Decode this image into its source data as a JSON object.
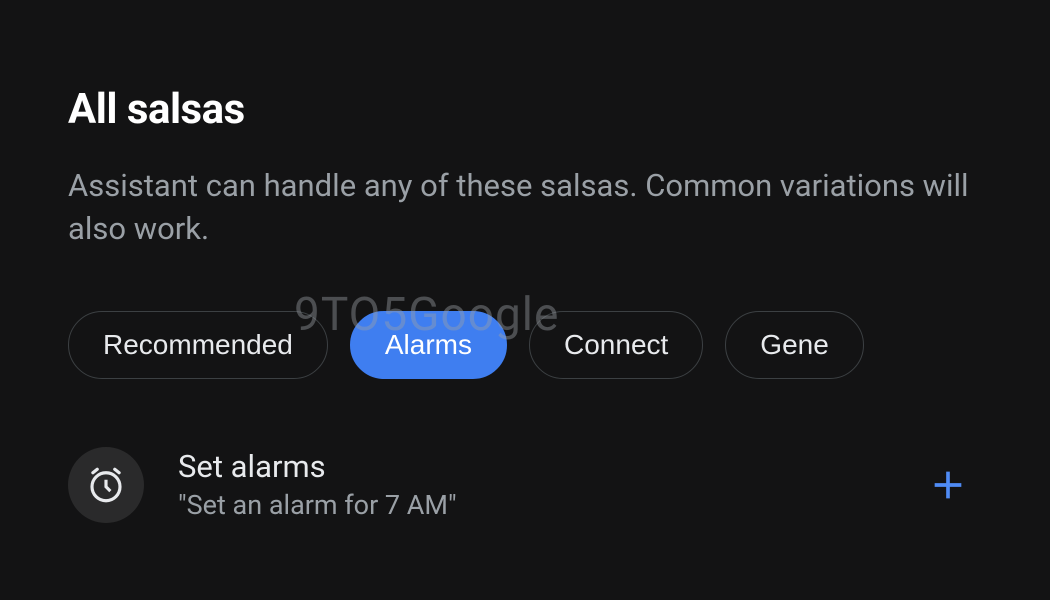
{
  "header": {
    "title": "All salsas",
    "description": "Assistant can handle any of these salsas. Common variations will also work."
  },
  "chips": {
    "items": [
      {
        "label": "Recommended",
        "active": false
      },
      {
        "label": "Alarms",
        "active": true
      },
      {
        "label": "Connect",
        "active": false
      },
      {
        "label": "Gene",
        "active": false
      }
    ]
  },
  "list": {
    "items": [
      {
        "icon": "alarm",
        "title": "Set alarms",
        "subtitle": "\"Set an alarm for 7 AM\""
      }
    ]
  },
  "watermark": "9TO5Google"
}
